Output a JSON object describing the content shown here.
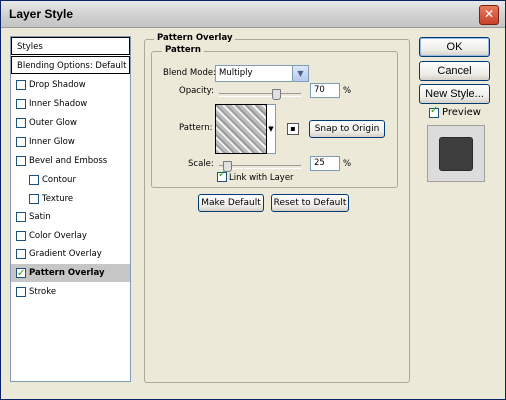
{
  "window": {
    "title": "Layer Style",
    "close_glyph": "✕"
  },
  "style_list": {
    "items": [
      {
        "label": "Styles",
        "type": "header",
        "checked": false
      },
      {
        "label": "Blending Options: Default",
        "type": "header",
        "checked": false
      },
      {
        "label": "Drop Shadow",
        "type": "check",
        "checked": false
      },
      {
        "label": "Inner Shadow",
        "type": "check",
        "checked": false
      },
      {
        "label": "Outer Glow",
        "type": "check",
        "checked": false
      },
      {
        "label": "Inner Glow",
        "type": "check",
        "checked": false
      },
      {
        "label": "Bevel and Emboss",
        "type": "check",
        "checked": false
      },
      {
        "label": "Contour",
        "type": "subcheck",
        "checked": false
      },
      {
        "label": "Texture",
        "type": "subcheck",
        "checked": false
      },
      {
        "label": "Satin",
        "type": "check",
        "checked": false
      },
      {
        "label": "Color Overlay",
        "type": "check",
        "checked": false
      },
      {
        "label": "Gradient Overlay",
        "type": "check",
        "checked": false
      },
      {
        "label": "Pattern Overlay",
        "type": "check",
        "checked": true,
        "selected": true
      },
      {
        "label": "Stroke",
        "type": "check",
        "checked": false
      }
    ]
  },
  "pattern_overlay": {
    "outer_legend": "Pattern Overlay",
    "inner_legend": "Pattern",
    "blend_mode_label": "Blend Mode:",
    "blend_mode_value": "Multiply",
    "opacity_label": "Opacity:",
    "opacity_value": "70",
    "opacity_level": 0.7,
    "percent_sign": "%",
    "pattern_label": "Pattern:",
    "snap_button": "Snap to Origin",
    "scale_label": "Scale:",
    "scale_value": "25",
    "scale_level": 0.05,
    "link_label": "Link with Layer",
    "link_checked": true,
    "make_default_button": "Make Default",
    "reset_default_button": "Reset to Default"
  },
  "right_panel": {
    "ok_button": "OK",
    "cancel_button": "Cancel",
    "new_style_button": "New Style...",
    "preview_label": "Preview",
    "preview_checked": true
  },
  "icons": {
    "dropdown_arrow": "▼",
    "new_preset": "page-corner-icon"
  },
  "colors": {
    "dialog_bg": "#ece9d8",
    "button_border": "#003c74",
    "checkmark": "#21a121",
    "selected_row": "#c6c6c6"
  }
}
